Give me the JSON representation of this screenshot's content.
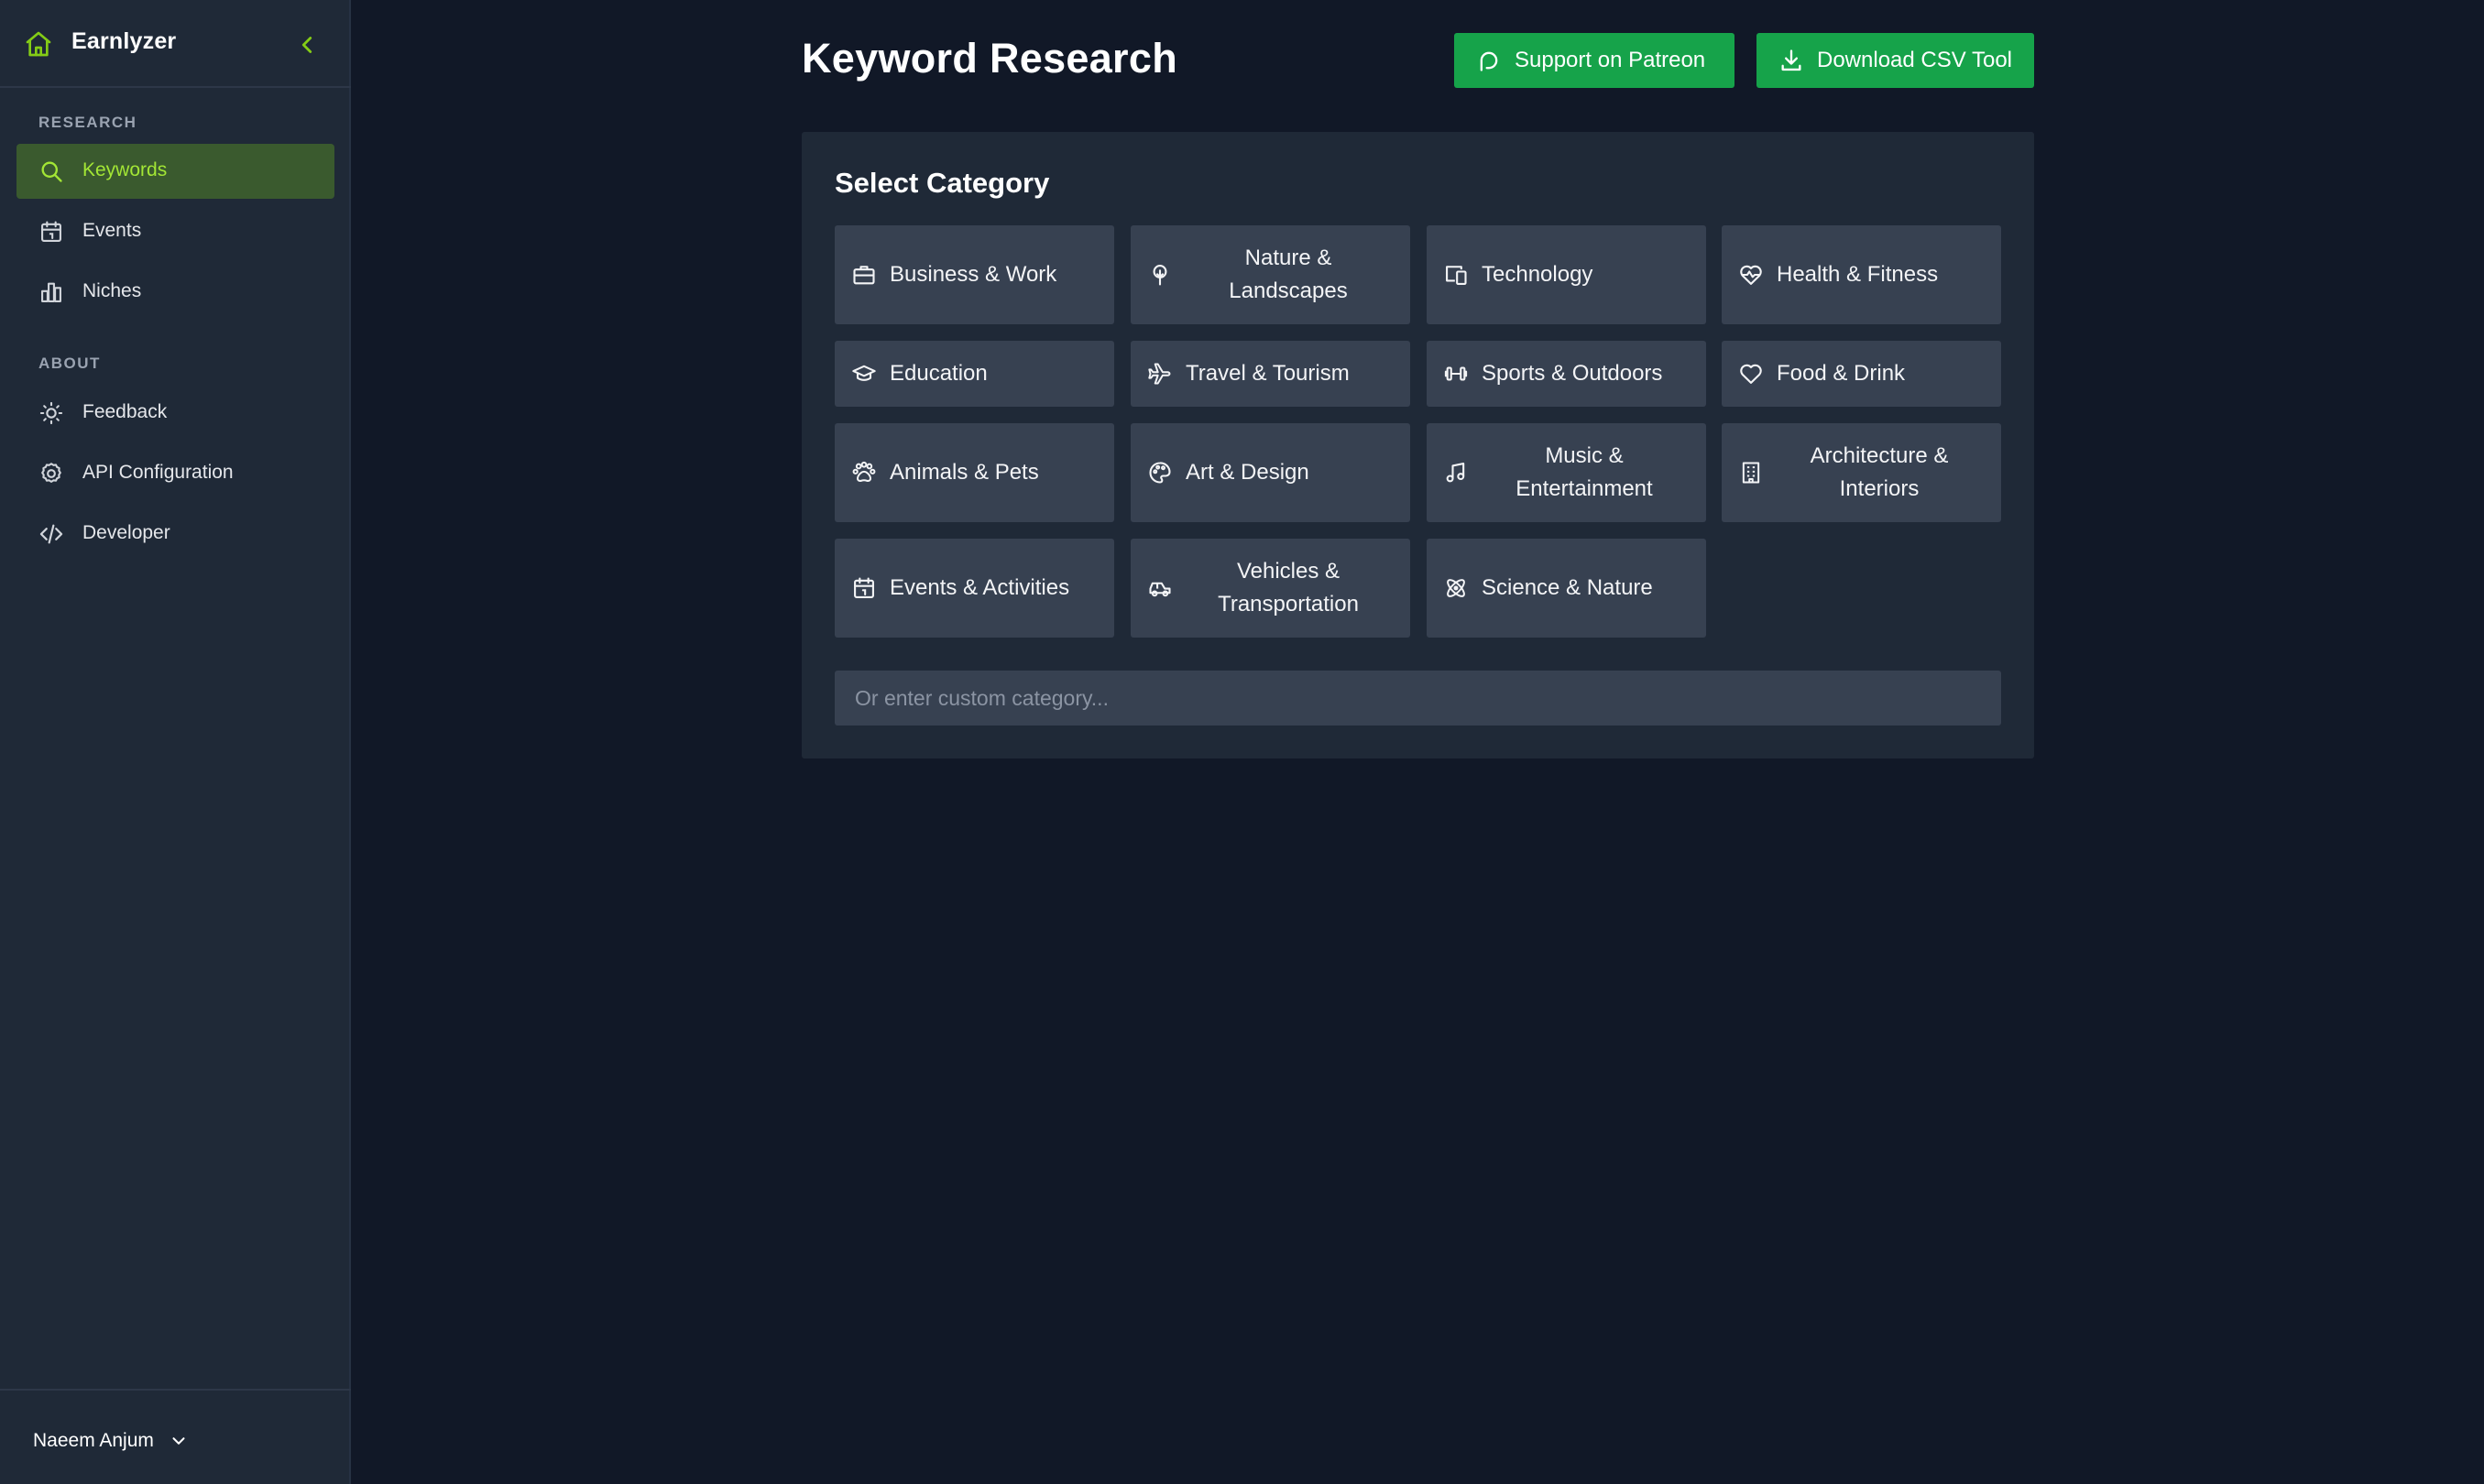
{
  "app": {
    "name": "Earnlyzer"
  },
  "sidebar": {
    "sections": [
      {
        "label": "RESEARCH"
      },
      {
        "label": "ABOUT"
      }
    ],
    "items": [
      {
        "label": "Keywords",
        "icon": "search-icon",
        "active": true
      },
      {
        "label": "Events",
        "icon": "calendar-icon",
        "active": false
      },
      {
        "label": "Niches",
        "icon": "bar-chart-icon",
        "active": false
      },
      {
        "label": "Feedback",
        "icon": "lightbulb-icon",
        "active": false
      },
      {
        "label": "API Configuration",
        "icon": "gear-icon",
        "active": false
      },
      {
        "label": "Developer",
        "icon": "code-icon",
        "active": false
      }
    ],
    "user": {
      "name": "Naeem Anjum"
    }
  },
  "header": {
    "title": "Keyword Research",
    "buttons": {
      "patreon": "Support on Patreon",
      "csv": "Download CSV Tool"
    }
  },
  "panel": {
    "title": "Select Category",
    "categories": [
      {
        "label": "Business & Work",
        "icon": "briefcase-icon"
      },
      {
        "label": "Nature & Landscapes",
        "icon": "tree-icon"
      },
      {
        "label": "Technology",
        "icon": "devices-icon"
      },
      {
        "label": "Health & Fitness",
        "icon": "heart-pulse-icon"
      },
      {
        "label": "Education",
        "icon": "graduation-cap-icon"
      },
      {
        "label": "Travel & Tourism",
        "icon": "plane-icon"
      },
      {
        "label": "Sports & Outdoors",
        "icon": "dumbbell-icon"
      },
      {
        "label": "Food & Drink",
        "icon": "heart-icon"
      },
      {
        "label": "Animals & Pets",
        "icon": "paw-icon"
      },
      {
        "label": "Art & Design",
        "icon": "palette-icon"
      },
      {
        "label": "Music & Entertainment",
        "icon": "music-note-icon"
      },
      {
        "label": "Architecture & Interiors",
        "icon": "building-icon"
      },
      {
        "label": "Events & Activities",
        "icon": "calendar-icon"
      },
      {
        "label": "Vehicles & Transportation",
        "icon": "car-icon"
      },
      {
        "label": "Science & Nature",
        "icon": "atom-icon"
      }
    ],
    "custom_placeholder": "Or enter custom category..."
  },
  "colors": {
    "background": "#111827",
    "sidebar": "#1f2937",
    "accent_green": "#16a34a",
    "active_text": "#a3e635",
    "active_bg": "#3a5a2e",
    "tile": "#374151"
  }
}
